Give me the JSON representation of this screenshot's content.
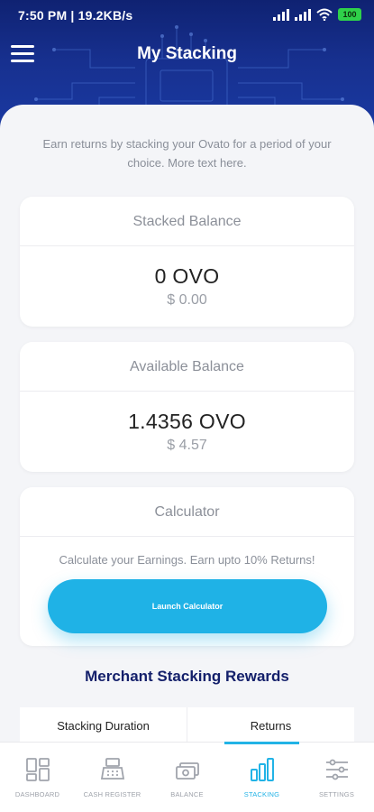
{
  "status_bar": {
    "time_speed": "7:50 PM | 19.2KB/s",
    "battery": "100"
  },
  "header": {
    "title": "My Stacking",
    "menu_icon": "hamburger-menu-icon"
  },
  "intro_text": "Earn returns by stacking your Ovato for a period of your choice. More text here.",
  "stacked_balance": {
    "title": "Stacked Balance",
    "amount": "0 OVO",
    "usd": "$ 0.00"
  },
  "available_balance": {
    "title": "Available Balance",
    "amount": "1.4356 OVO",
    "usd": "$ 4.57"
  },
  "calculator": {
    "title": "Calculator",
    "description": "Calculate your Earnings. Earn upto 10% Returns!",
    "button_label": "Launch Calculator"
  },
  "rewards": {
    "title": "Merchant Stacking Rewards",
    "columns": [
      "Stacking Duration",
      "Returns"
    ]
  },
  "bottom_nav": {
    "items": [
      {
        "label": "DASHBOARD",
        "icon": "dashboard-icon"
      },
      {
        "label": "CASH REGISTER",
        "icon": "cash-register-icon"
      },
      {
        "label": "BALANCE",
        "icon": "balance-icon"
      },
      {
        "label": "STACKING",
        "icon": "stacking-icon"
      },
      {
        "label": "SETTINGS",
        "icon": "settings-icon"
      }
    ],
    "active": "STACKING"
  },
  "colors": {
    "header": "#17308f",
    "accent": "#1fb2e6",
    "rewards_title": "#14206b"
  }
}
